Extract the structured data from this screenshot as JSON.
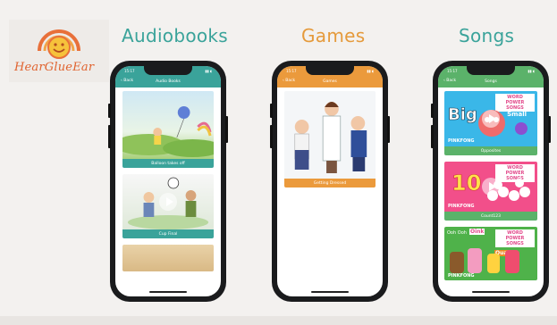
{
  "brand": {
    "logo_text": "HearGlueEar",
    "accent": "#e8703a"
  },
  "columns": [
    {
      "title": "Audiobooks",
      "title_color": "#3aa39a",
      "bar_color": "#3aa39a",
      "screen_title": "Audio Books",
      "back_label": "Back",
      "time": "15:17",
      "cards": [
        {
          "caption": "Balloon takes off"
        },
        {
          "caption": "Cup Final"
        }
      ]
    },
    {
      "title": "Games",
      "title_color": "#e59a3b",
      "bar_color": "#eb9a3c",
      "screen_title": "Games",
      "back_label": "Back",
      "time": "15:17",
      "cards": [
        {
          "caption": "Getting Dressed"
        }
      ]
    },
    {
      "title": "Songs",
      "title_color": "#3aa39a",
      "bar_color": "#5bb26a",
      "screen_title": "Songs",
      "back_label": "Back",
      "time": "15:17",
      "cards": [
        {
          "caption": "Opposites",
          "badge": "WORD POWER SONGS",
          "big": "Big",
          "small": "Small",
          "brand": "PINKFONG"
        },
        {
          "caption": "Count123",
          "badge": "WORD POWER SONGS",
          "big": "10",
          "brand": "PINKFONG"
        },
        {
          "badge": "WORD POWER SONGS",
          "sound1": "Ooh Ooh",
          "sound2": "Oink",
          "sound3": "Quack",
          "brand": "PINKFONG"
        }
      ]
    }
  ]
}
